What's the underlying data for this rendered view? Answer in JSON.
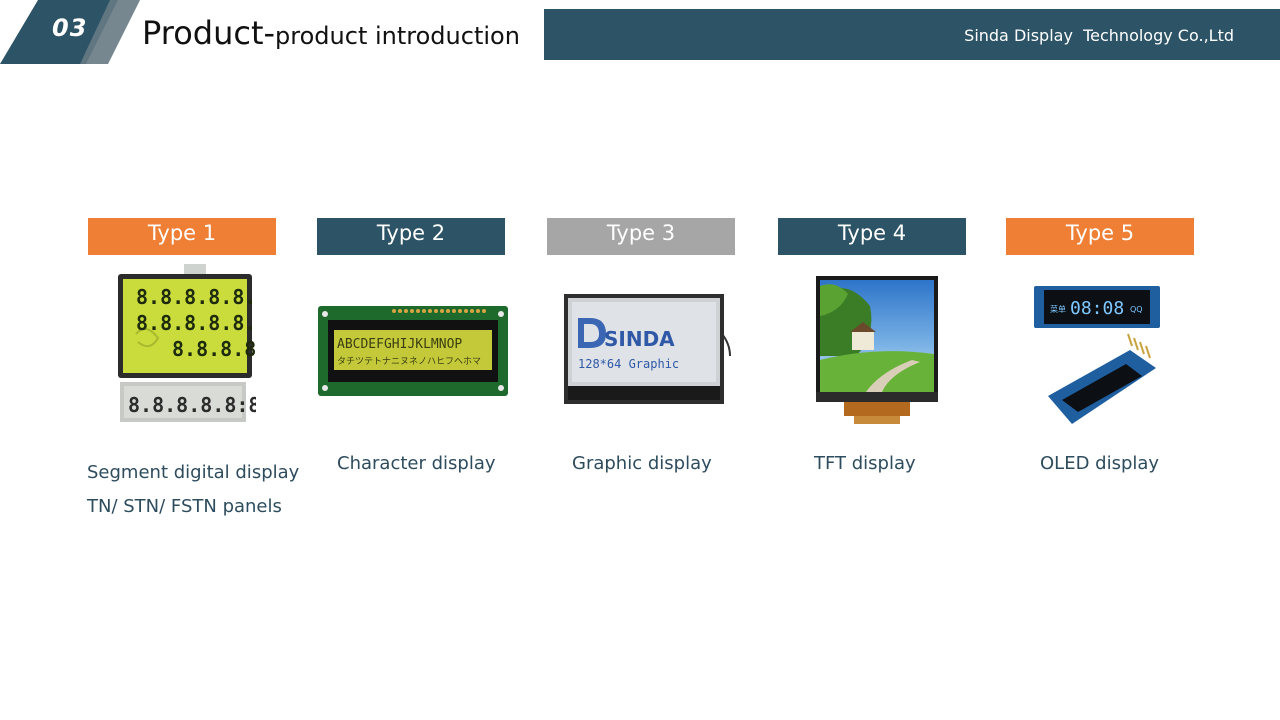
{
  "header": {
    "section_number": "03",
    "title_main": "Product-",
    "title_sub": "product introduction",
    "company": "Sinda Display  Technology Co.,Ltd"
  },
  "colors": {
    "navy": "#2c5366",
    "orange": "#ee7f35",
    "gray": "#a6a6a6",
    "caption": "#2d4c5d"
  },
  "products": [
    {
      "type_label": "Type 1",
      "tab_color": "#ee7f35",
      "image_icon": "segment-lcd-icon",
      "segment_rows": [
        "8.8.8.8.8.8",
        "8.8.8.8.8.8",
        "8.8.8.8"
      ],
      "segment_lower": "8.8.8.8.8:8.8",
      "caption_lines": [
        "Segment digital display",
        "TN/ STN/ FSTN panels"
      ]
    },
    {
      "type_label": "Type 2",
      "tab_color": "#2c5366",
      "image_icon": "character-lcd-icon",
      "screen_line1": "ABCDEFGHIJKLMNOP",
      "screen_line2": "タチツテトナニヌネノハヒフヘホマ",
      "caption_lines": [
        "Character display"
      ]
    },
    {
      "type_label": "Type 3",
      "tab_color": "#a6a6a6",
      "image_icon": "graphic-lcd-icon",
      "logo_text": "SINDA",
      "screen_text": "128*64 Graphic",
      "caption_lines": [
        "Graphic display"
      ]
    },
    {
      "type_label": "Type 4",
      "tab_color": "#2c5366",
      "image_icon": "tft-display-icon",
      "caption_lines": [
        "TFT display"
      ]
    },
    {
      "type_label": "Type 5",
      "tab_color": "#ee7f35",
      "image_icon": "oled-display-icon",
      "oled_time": "08:08",
      "oled_small_left": "菜单",
      "oled_small_right": "QQ",
      "caption_lines": [
        "OLED display"
      ]
    }
  ]
}
